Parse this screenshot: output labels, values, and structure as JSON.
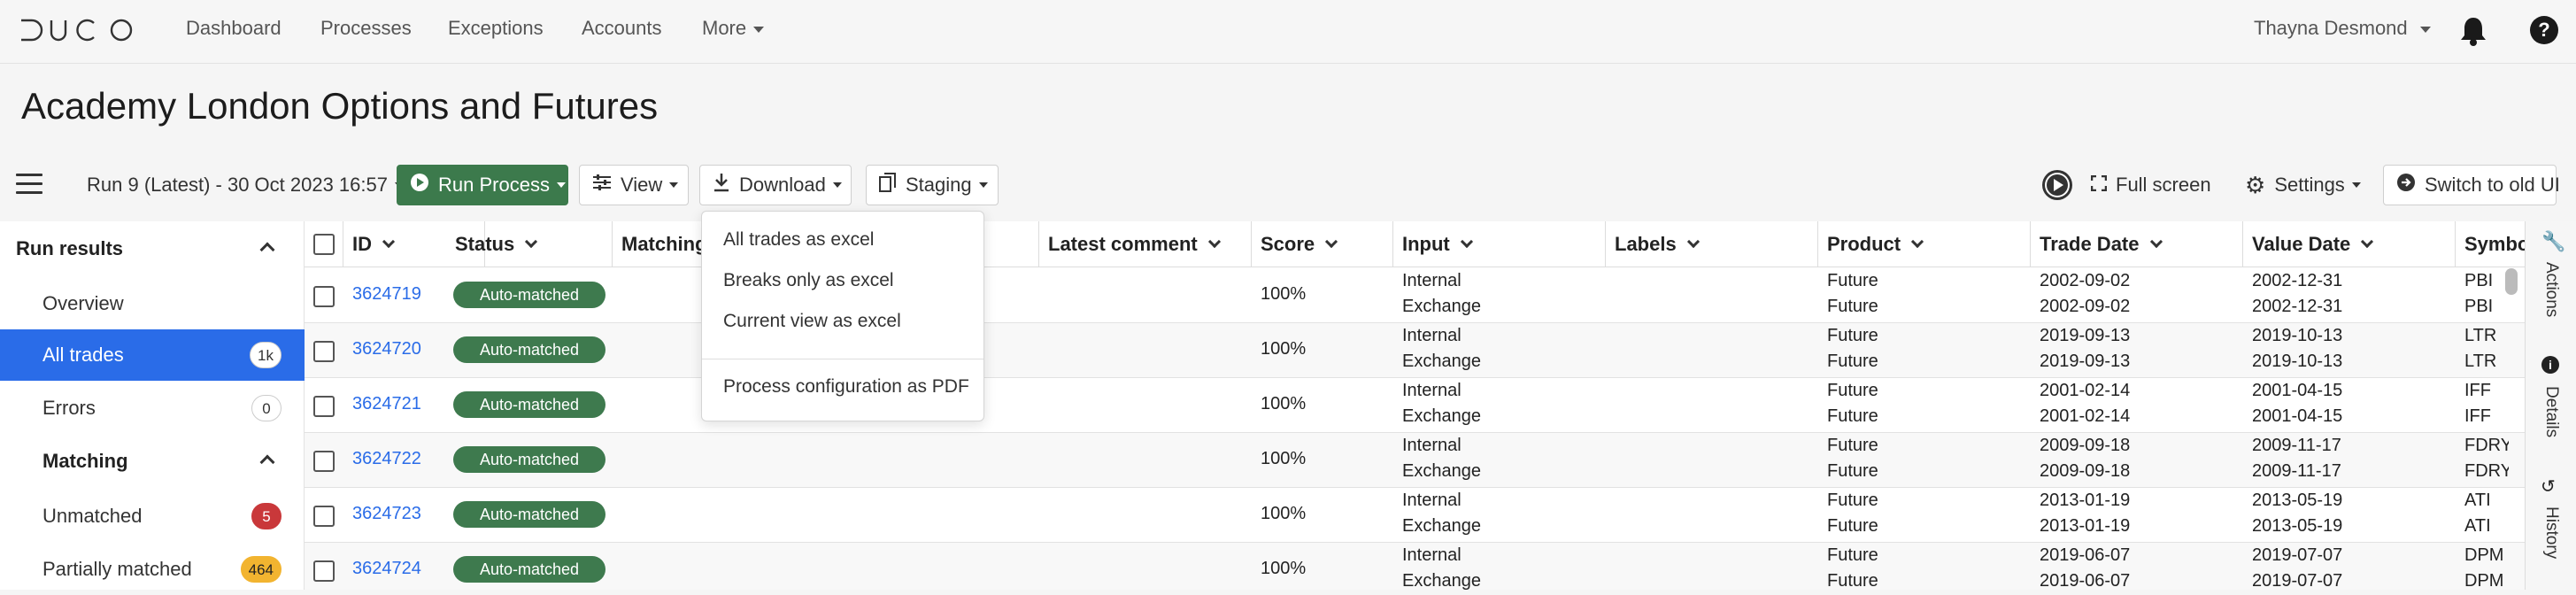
{
  "app": {
    "logo_text": "DUCO"
  },
  "nav": {
    "items": [
      "Dashboard",
      "Processes",
      "Exceptions",
      "Accounts"
    ],
    "more": "More",
    "user": "Thayna Desmond"
  },
  "page_title": "Academy London Options and Futures",
  "toolbar": {
    "run": "Run 9 (Latest) - 30 Oct 2023 16:57",
    "run_process": "Run Process",
    "view": "View",
    "download": "Download",
    "staging": "Staging",
    "full_screen": "Full screen",
    "settings": "Settings",
    "switch": "Switch to old UI"
  },
  "sidebar": {
    "run_results": "Run results",
    "overview": "Overview",
    "all_trades": "All trades",
    "all_trades_count": "1k",
    "errors": "Errors",
    "errors_count": "0",
    "matching": "Matching",
    "unmatched": "Unmatched",
    "unmatched_count": "5",
    "partially": "Partially matched",
    "partially_count": "464"
  },
  "columns": [
    "ID",
    "Status",
    "Matching",
    "Latest comment",
    "Score",
    "Input",
    "Labels",
    "Product",
    "Trade Date",
    "Value Date",
    "Symbol"
  ],
  "rows": [
    {
      "id": "3624719",
      "status": "Auto-matched",
      "score": "100%",
      "input1": "Internal",
      "input2": "Exchange",
      "product1": "Future",
      "product2": "Future",
      "trade1": "2002-09-02",
      "trade2": "2002-09-02",
      "value1": "2002-12-31",
      "value2": "2002-12-31",
      "sym1": "PBI",
      "sym2": "PBI"
    },
    {
      "id": "3624720",
      "status": "Auto-matched",
      "score": "100%",
      "input1": "Internal",
      "input2": "Exchange",
      "product1": "Future",
      "product2": "Future",
      "trade1": "2019-09-13",
      "trade2": "2019-09-13",
      "value1": "2019-10-13",
      "value2": "2019-10-13",
      "sym1": "LTR",
      "sym2": "LTR"
    },
    {
      "id": "3624721",
      "status": "Auto-matched",
      "score": "100%",
      "input1": "Internal",
      "input2": "Exchange",
      "product1": "Future",
      "product2": "Future",
      "trade1": "2001-02-14",
      "trade2": "2001-02-14",
      "value1": "2001-04-15",
      "value2": "2001-04-15",
      "sym1": "IFF",
      "sym2": "IFF"
    },
    {
      "id": "3624722",
      "status": "Auto-matched",
      "score": "100%",
      "input1": "Internal",
      "input2": "Exchange",
      "product1": "Future",
      "product2": "Future",
      "trade1": "2009-09-18",
      "trade2": "2009-09-18",
      "value1": "2009-11-17",
      "value2": "2009-11-17",
      "sym1": "FDRY",
      "sym2": "FDRY"
    },
    {
      "id": "3624723",
      "status": "Auto-matched",
      "score": "100%",
      "input1": "Internal",
      "input2": "Exchange",
      "product1": "Future",
      "product2": "Future",
      "trade1": "2013-01-19",
      "trade2": "2013-01-19",
      "value1": "2013-05-19",
      "value2": "2013-05-19",
      "sym1": "ATI",
      "sym2": "ATI"
    },
    {
      "id": "3624724",
      "status": "Auto-matched",
      "score": "100%",
      "input1": "Internal",
      "input2": "Exchange",
      "product1": "Future",
      "product2": "Future",
      "trade1": "2019-06-07",
      "trade2": "2019-06-07",
      "value1": "2019-07-07",
      "value2": "2019-07-07",
      "sym1": "DPM",
      "sym2": "DPM"
    }
  ],
  "rail": {
    "actions": "Actions",
    "details": "Details",
    "history": "History"
  },
  "download_menu": {
    "all_excel": "All trades as excel",
    "breaks_excel": "Breaks only as excel",
    "current_excel": "Current view as excel",
    "config_pdf": "Process configuration as PDF"
  }
}
